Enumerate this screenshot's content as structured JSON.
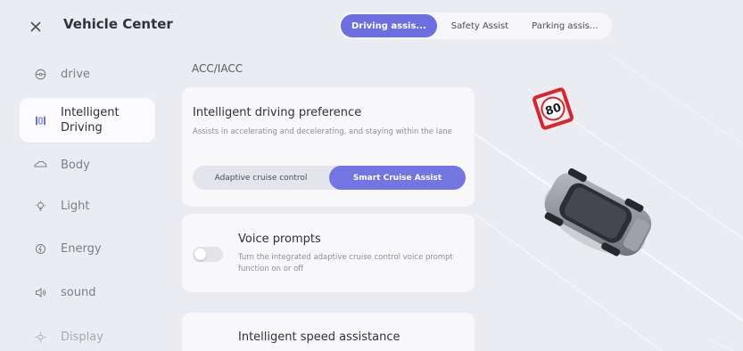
{
  "header": {
    "close_icon": "close-icon",
    "title": "Vehicle Center",
    "tabs": [
      {
        "label": "Driving assis...",
        "active": true
      },
      {
        "label": "Safety Assist",
        "active": false
      },
      {
        "label": "Parking assis...",
        "active": false
      }
    ]
  },
  "sidebar": {
    "items": [
      {
        "label": "drive",
        "icon": "steering-wheel-icon",
        "active": false
      },
      {
        "label": "Intelligent Driving",
        "icon": "intelligent-driving-icon",
        "active": true
      },
      {
        "label": "Body",
        "icon": "car-body-icon",
        "active": false
      },
      {
        "label": "Light",
        "icon": "light-icon",
        "active": false
      },
      {
        "label": "Energy",
        "icon": "energy-icon",
        "active": false
      },
      {
        "label": "sound",
        "icon": "speaker-icon",
        "active": false
      },
      {
        "label": "Display",
        "icon": "display-icon",
        "active": false
      }
    ]
  },
  "main": {
    "section_title": "ACC/IACC",
    "preference": {
      "title": "Intelligent driving preference",
      "description": "Assists in accelerating and decelerating, and staying within the lane",
      "options": [
        {
          "label": "Adaptive cruise control",
          "selected": false
        },
        {
          "label": "Smart Cruise Assist",
          "selected": true
        }
      ]
    },
    "voice": {
      "title": "Voice prompts",
      "description": "Turn the integrated adaptive cruise control voice prompt function on or off",
      "enabled": false
    },
    "speed": {
      "title": "Intelligent speed assistance"
    }
  },
  "scene": {
    "speed_sign": "80",
    "sign_color": "#d9262e",
    "accent": "#6b6fe0"
  }
}
